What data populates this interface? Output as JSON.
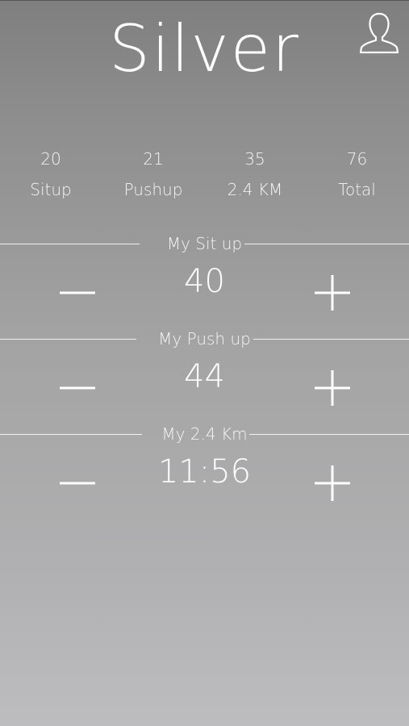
{
  "header": {
    "title": "Silver",
    "profile_icon": "user-icon"
  },
  "stats": [
    {
      "value": "20",
      "label": "Situp"
    },
    {
      "value": "21",
      "label": "Pushup"
    },
    {
      "value": "35",
      "label": "2.4 KM"
    },
    {
      "value": "76",
      "label": "Total"
    }
  ],
  "sections": [
    {
      "title": "My Sit up",
      "value": "40",
      "minus_icon": "minus-icon",
      "plus_icon": "plus-icon"
    },
    {
      "title": "My Push up",
      "value": "44",
      "minus_icon": "minus-icon",
      "plus_icon": "plus-icon"
    },
    {
      "title": "My 2.4 Km",
      "value": "11:56",
      "minus_icon": "minus-icon",
      "plus_icon": "plus-icon"
    }
  ],
  "colors": {
    "background_top": "#7f7f7f",
    "background_bottom": "#bdbdbf",
    "text": "#ffffff"
  }
}
